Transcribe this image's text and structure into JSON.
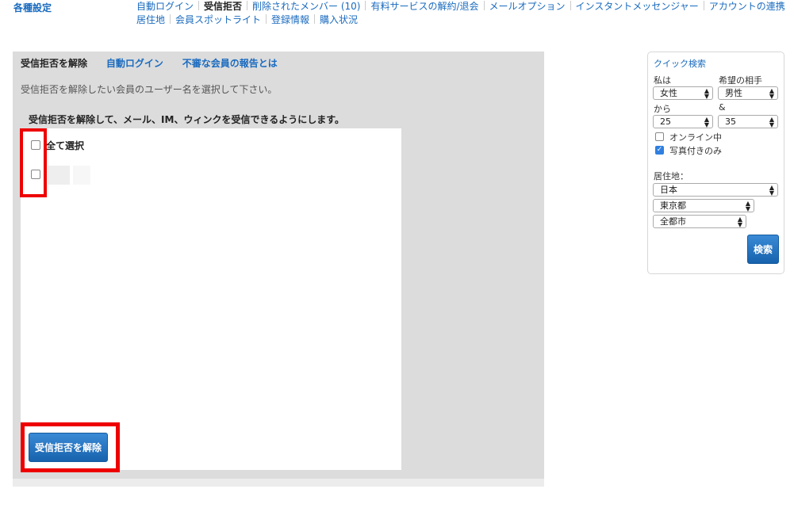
{
  "header": {
    "settings_title": "各種設定",
    "nav_row1": [
      {
        "label": "自動ログイン",
        "current": false
      },
      {
        "label": "受信拒否",
        "current": true
      },
      {
        "label": "削除されたメンバー (10)",
        "current": false
      },
      {
        "label": "有料サービスの解約/退会",
        "current": false
      },
      {
        "label": "メールオプション",
        "current": false
      },
      {
        "label": "インスタントメッセンジャー",
        "current": false
      },
      {
        "label": "アカウントの連携",
        "current": false
      }
    ],
    "nav_row2": [
      {
        "label": "居住地",
        "current": false
      },
      {
        "label": "会員スポットライト",
        "current": false
      },
      {
        "label": "登録情報",
        "current": false
      },
      {
        "label": "購入状況",
        "current": false
      }
    ]
  },
  "panel": {
    "tab_current": "受信拒否を解除",
    "tab_auto_login": "自動ログイン",
    "tab_report": "不審な会員の報告とは",
    "instruction": "受信拒否を解除したい会員のユーザー名を選択して下さい。",
    "explanation": "受信拒否を解除して、メール、IM、ウィンクを受信できるようにします。",
    "select_all": "全て選択",
    "unblock_button": "受信拒否を解除"
  },
  "quick_search": {
    "title": "クイック検索",
    "i_am_label": "私は",
    "i_am_value": "女性",
    "seeking_label": "希望の相手",
    "seeking_value": "男性",
    "from_label": "から",
    "and_label": "&",
    "age_from": "25",
    "age_to": "35",
    "online_label": "オンライン中",
    "online_checked": false,
    "photo_label": "写真付きのみ",
    "photo_checked": true,
    "residence_label": "居住地：",
    "country": "日本",
    "prefecture": "東京都",
    "city": "全都市",
    "search_button": "検索"
  }
}
